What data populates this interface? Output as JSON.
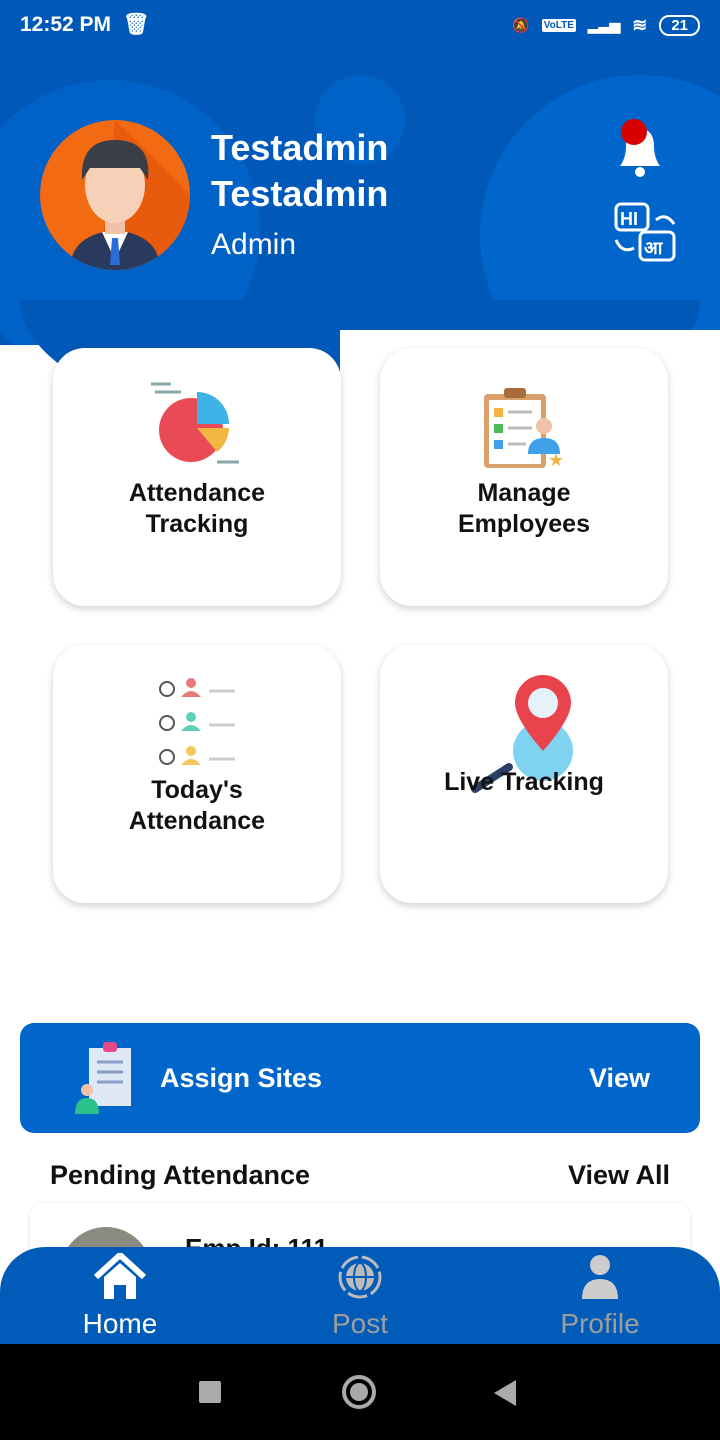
{
  "status_bar": {
    "time": "12:52 PM",
    "battery": "21",
    "network": "VoLTE"
  },
  "profile": {
    "first_name": "Testadmin",
    "last_name": "Testadmin",
    "role": "Admin"
  },
  "header_icons": {
    "notification": "bell-icon",
    "language": "language-translate-icon",
    "lang_hi": "HI",
    "lang_alt": "आ"
  },
  "cards": [
    {
      "label_line1": "Attendance",
      "label_line2": "Tracking",
      "icon": "pie-chart-icon"
    },
    {
      "label_line1": "Manage",
      "label_line2": "Employees",
      "icon": "clipboard-employee-icon"
    },
    {
      "label_line1": "Today's",
      "label_line2": "Attendance",
      "icon": "checklist-people-icon"
    },
    {
      "label_line1": "",
      "label_line2": "Live Tracking",
      "icon": "location-search-icon"
    }
  ],
  "assign_sites": {
    "label": "Assign Sites",
    "action": "View"
  },
  "pending": {
    "title": "Pending Attendance",
    "view_all": "View All",
    "items": [
      {
        "emp_id": "Emp Id: 111"
      }
    ]
  },
  "bottom_nav": [
    {
      "label": "Home",
      "active": true
    },
    {
      "label": "Post",
      "active": false
    },
    {
      "label": "Profile",
      "active": false
    }
  ],
  "colors": {
    "primary": "#0059b8",
    "accent": "#0066cc",
    "inactive": "#9e9e9e"
  }
}
